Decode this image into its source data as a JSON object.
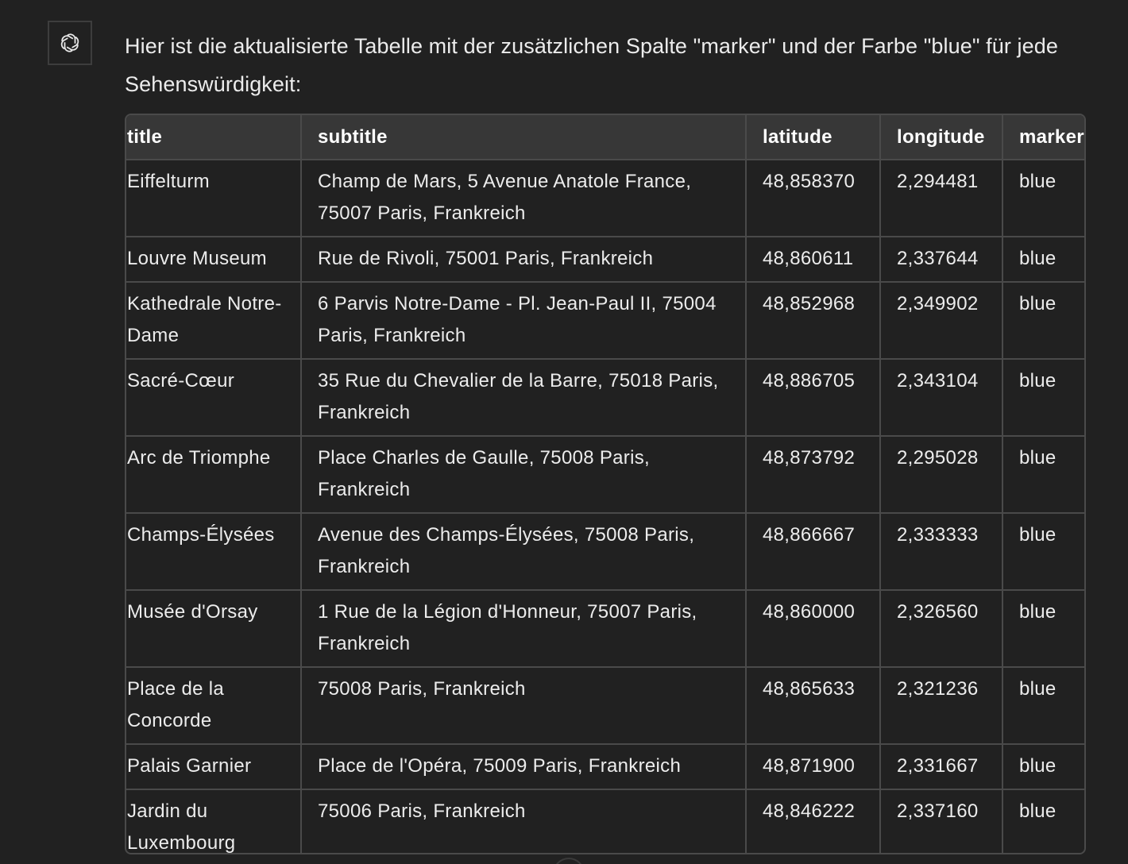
{
  "assistant": {
    "avatar_icon": "openai-logo-icon",
    "message": "Hier ist die aktualisierte Tabelle mit der zusätzlichen Spalte \"marker\" und der Farbe \"blue\" für jede Sehenswürdigkeit:"
  },
  "table": {
    "headers": {
      "title": "title",
      "subtitle": "subtitle",
      "latitude": "latitude",
      "longitude": "longitude",
      "marker": "marker"
    },
    "rows": [
      {
        "title": "Eiffelturm",
        "subtitle": "Champ de Mars, 5 Avenue Anatole France, 75007 Paris, Frankreich",
        "latitude": "48,858370",
        "longitude": "2,294481",
        "marker": "blue"
      },
      {
        "title": "Louvre Museum",
        "subtitle": "Rue de Rivoli, 75001 Paris, Frankreich",
        "latitude": "48,860611",
        "longitude": "2,337644",
        "marker": "blue"
      },
      {
        "title": "Kathedrale Notre-Dame",
        "subtitle": "6 Parvis Notre-Dame - Pl. Jean-Paul II, 75004 Paris, Frankreich",
        "latitude": "48,852968",
        "longitude": "2,349902",
        "marker": "blue"
      },
      {
        "title": "Sacré-Cœur",
        "subtitle": "35 Rue du Chevalier de la Barre, 75018 Paris, Frankreich",
        "latitude": "48,886705",
        "longitude": "2,343104",
        "marker": "blue"
      },
      {
        "title": "Arc de Triomphe",
        "subtitle": "Place Charles de Gaulle, 75008 Paris, Frankreich",
        "latitude": "48,873792",
        "longitude": "2,295028",
        "marker": "blue"
      },
      {
        "title": "Champs-Élysées",
        "subtitle": "Avenue des Champs-Élysées, 75008 Paris, Frankreich",
        "latitude": "48,866667",
        "longitude": "2,333333",
        "marker": "blue"
      },
      {
        "title": "Musée d'Orsay",
        "subtitle": "1 Rue de la Légion d'Honneur, 75007 Paris, Frankreich",
        "latitude": "48,860000",
        "longitude": "2,326560",
        "marker": "blue"
      },
      {
        "title": "Place de la Concorde",
        "subtitle": "75008 Paris, Frankreich",
        "latitude": "48,865633",
        "longitude": "2,321236",
        "marker": "blue"
      },
      {
        "title": "Palais Garnier",
        "subtitle": "Place de l'Opéra, 75009 Paris, Frankreich",
        "latitude": "48,871900",
        "longitude": "2,331667",
        "marker": "blue"
      },
      {
        "title": "Jardin du Luxembourg",
        "subtitle": "75006 Paris, Frankreich",
        "latitude": "48,846222",
        "longitude": "2,337160",
        "marker": "blue"
      }
    ]
  }
}
